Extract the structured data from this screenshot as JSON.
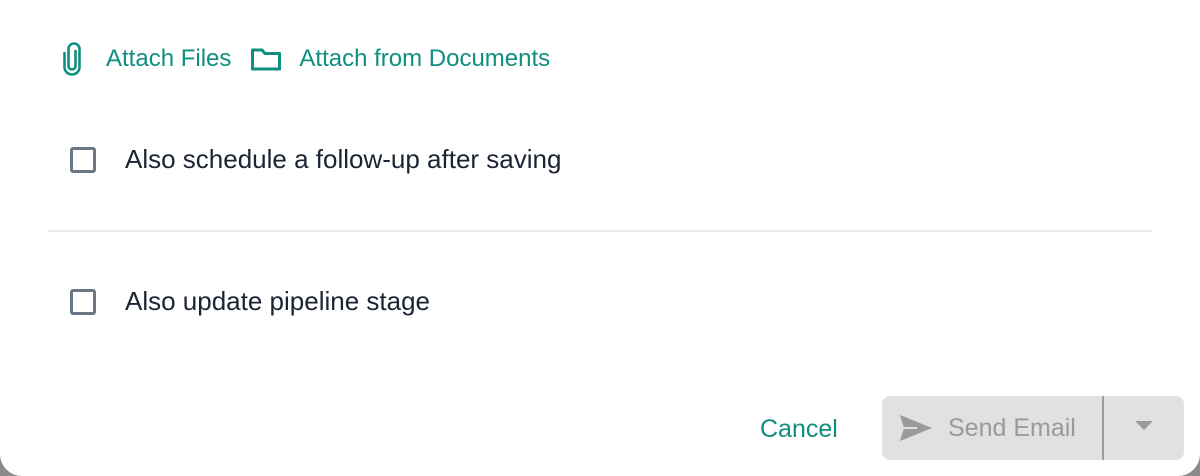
{
  "attachments": {
    "attach_files_label": "Attach Files",
    "attach_documents_label": "Attach from Documents",
    "paperclip_icon": "paperclip-icon",
    "folder_icon": "folder-icon"
  },
  "options": [
    {
      "label": "Also schedule a follow-up after saving",
      "checked": false
    },
    {
      "label": "Also update pipeline stage",
      "checked": false
    }
  ],
  "footer": {
    "cancel_label": "Cancel",
    "send_label": "Send Email",
    "send_disabled": true,
    "send_icon": "paper-plane-icon",
    "dropdown_icon": "caret-down-icon"
  },
  "colors": {
    "accent": "#0f8f7f",
    "text": "#1b2433",
    "checkbox_border": "#6b7785",
    "disabled_bg": "#e1e1e1",
    "disabled_text": "#9a9a9a",
    "divider": "#e8e8f0"
  }
}
